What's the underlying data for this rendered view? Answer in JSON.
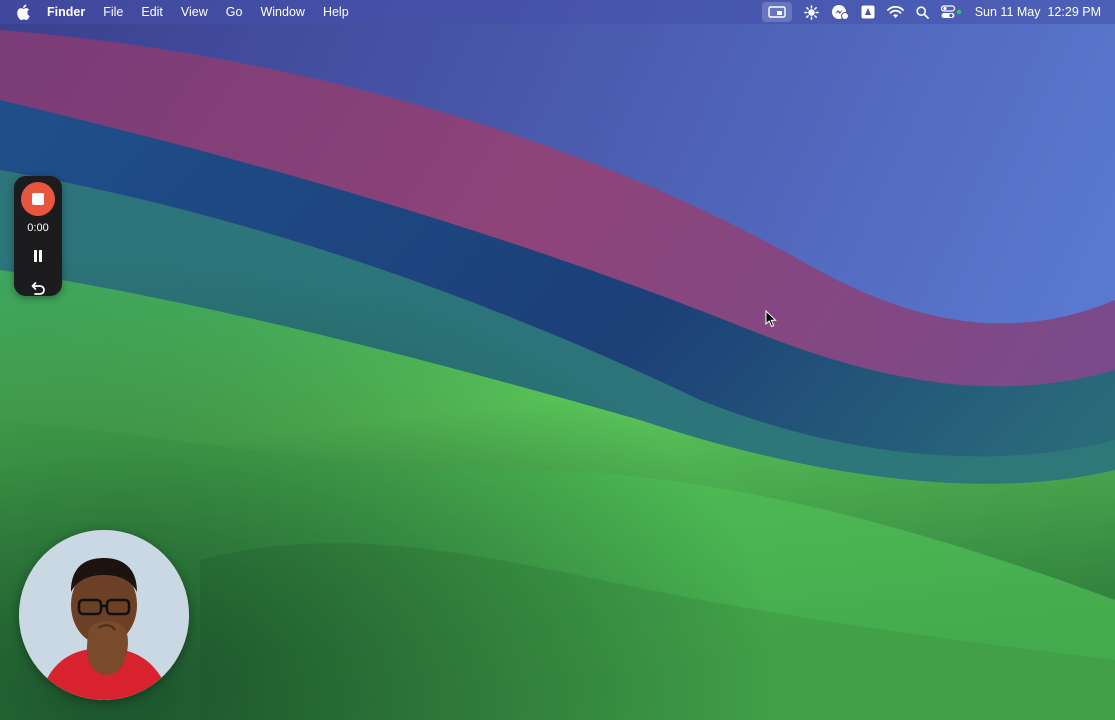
{
  "menubar": {
    "apple_icon": "apple-logo-icon",
    "app_name": "Finder",
    "menus": [
      "File",
      "Edit",
      "View",
      "Go",
      "Window",
      "Help"
    ],
    "status_icons": [
      "screen-record-icon",
      "sun-gear-icon",
      "messenger-icon",
      "drive-icon",
      "wifi-icon",
      "search-icon",
      "control-center-icon"
    ],
    "clock": {
      "date": "Sun 11 May",
      "time": "12:29 PM"
    }
  },
  "recorder": {
    "elapsed": "0:00",
    "stop_icon": "stop-icon",
    "pause_icon": "pause-icon",
    "restart_icon": "restart-icon",
    "accent_color": "#e8553e"
  },
  "webcam": {
    "icon": "webcam-person-icon"
  },
  "colors": {
    "wallpaper_blue": "#3a4fa8",
    "wallpaper_magenta": "#8a3f7a",
    "wallpaper_green": "#5cc85a"
  }
}
